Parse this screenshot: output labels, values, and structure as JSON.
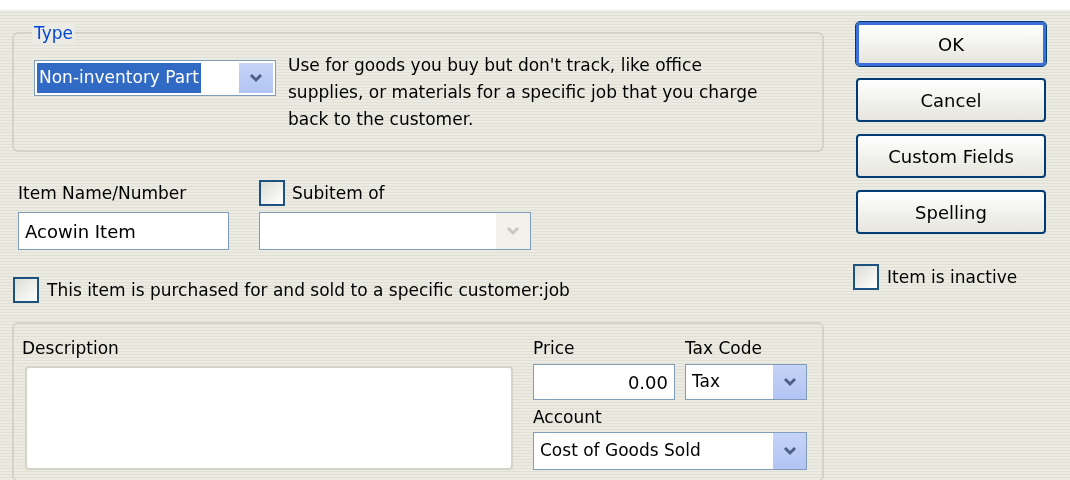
{
  "type_group": {
    "legend": "Type",
    "dropdown": {
      "value": "Non-inventory Part",
      "selected": true
    },
    "help_text": "Use for goods you buy but don't track, like office supplies, or materials for a specific job that you charge back to the customer."
  },
  "item_name": {
    "label": "Item Name/Number",
    "value": "Acowin Item"
  },
  "subitem": {
    "label": "Subitem of",
    "checked": false,
    "disabled": true
  },
  "specific_customer": {
    "label": "This item is purchased for and sold to a specific customer:job",
    "checked": false
  },
  "purchase": {
    "description_label": "Description",
    "price_label": "Price",
    "price": "0.00",
    "tax_code_label": "Tax Code",
    "tax_code": "Tax",
    "account_label": "Account",
    "account": "Cost of Goods Sold"
  },
  "buttons": [
    {
      "label": "OK",
      "default": true
    },
    {
      "label": "Cancel",
      "default": false
    },
    {
      "label": "Custom Fields",
      "default": false
    },
    {
      "label": "Spelling",
      "default": false
    }
  ],
  "inactive": {
    "label": "Item is inactive",
    "checked": false
  }
}
